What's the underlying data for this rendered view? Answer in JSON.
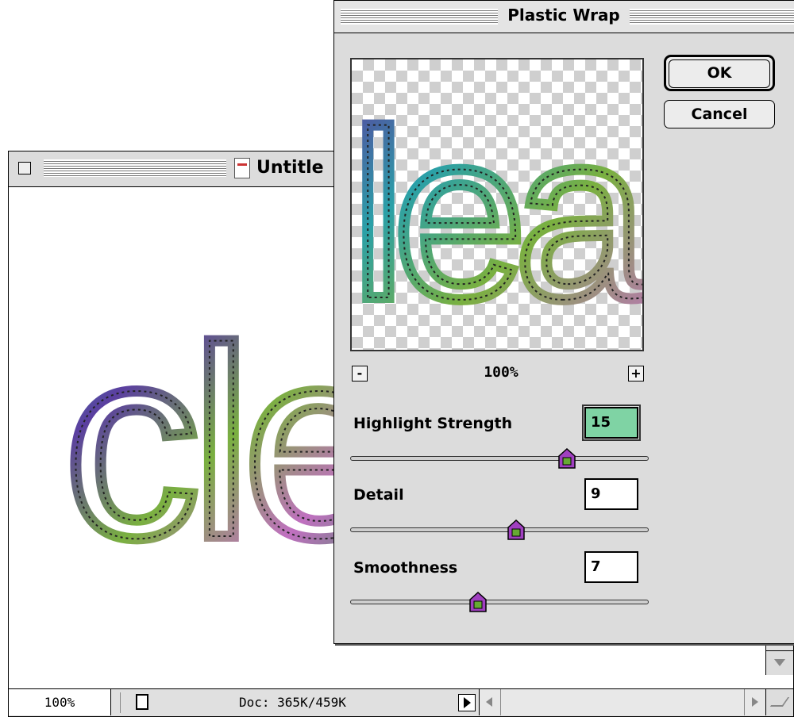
{
  "document_window": {
    "title": "Untitle",
    "canvas_text": "cle",
    "status": {
      "zoom": "100%",
      "doc_info": "Doc: 365K/459K"
    }
  },
  "dialog": {
    "title": "Plastic Wrap",
    "preview": {
      "text": "lea",
      "zoom": "100%",
      "zoom_out_label": "-",
      "zoom_in_label": "+"
    },
    "buttons": {
      "ok": "OK",
      "cancel": "Cancel"
    },
    "parameters": [
      {
        "label": "Highlight Strength",
        "value": "15",
        "max": 20
      },
      {
        "label": "Detail",
        "value": "9",
        "max": 15
      },
      {
        "label": "Smoothness",
        "value": "7",
        "max": 15
      }
    ]
  },
  "colors": {
    "window_gray": "#dcdcdc",
    "selection_highlight": "#7fd3a4",
    "thumb_purple": "#a040c0",
    "text_rainbow": [
      "#3a8f5a",
      "#5b3fa0",
      "#2aa0a8",
      "#7ab040",
      "#c070c0"
    ]
  },
  "icons": [
    "close-box-icon",
    "document-icon",
    "zoom-out-icon",
    "zoom-in-icon",
    "slider-thumb-icon",
    "arrow-right-icon",
    "scroll-down-icon",
    "grow-box-icon"
  ]
}
